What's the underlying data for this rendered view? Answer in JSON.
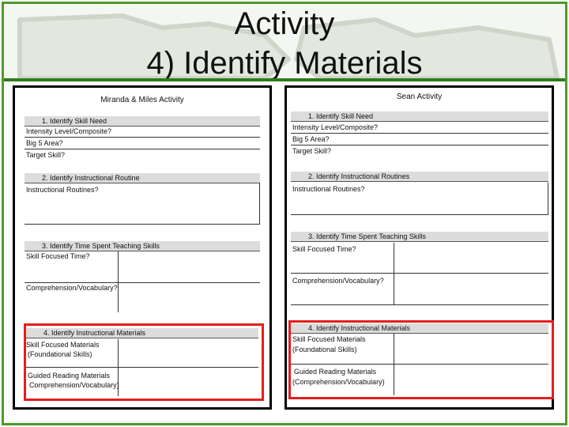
{
  "slide": {
    "title_line1": "Activity",
    "title_line2": "4) Identify Materials"
  },
  "left": {
    "title": "Miranda & Miles Activity",
    "sec1": "1.  Identify Skill Need",
    "intensity": "Intensity Level/Composite?",
    "big5": "Big 5 Area?",
    "target": "Target Skill?",
    "sec2": "2.  Identify Instructional Routine",
    "routines": "Instructional Routines?",
    "sec3": "3.  Identify Time Spent Teaching Skills",
    "skill_time": "Skill Focused Time?",
    "comp_vocab": "Comprehension/Vocabulary?",
    "sec4": "4.  Identify Instructional Materials",
    "skill_mat_1": "Skill Focused Materials",
    "skill_mat_2": "(Foundational Skills)",
    "guided_1": "Guided Reading Materials",
    "guided_2": "Comprehension/Vocabulary)"
  },
  "right": {
    "title": "Sean Activity",
    "sec1": "1.  Identify Skill Need",
    "intensity": "Intensity Level/Composite?",
    "big5": "Big 5 Area?",
    "target": "Target Skill?",
    "sec2": "2.  Identify Instructional Routines",
    "routines": "Instructional Routines?",
    "sec3": "3.  Identify Time Spent Teaching Skills",
    "skill_time": "Skill Focused Time?",
    "comp_vocab": "Comprehension/Vocabulary?",
    "sec4": "4.  Identify Instructional Materials",
    "skill_mat_1": "Skill Focused Materials",
    "skill_mat_2": "(Foundational Skills)",
    "guided_1": "Guided Reading Materials",
    "guided_2": "(Comprehension/Vocabulary)"
  },
  "colors": {
    "frame_green": "#4e9a2c",
    "highlight_red": "#e41e1e",
    "section_gray": "#dcdcdc"
  }
}
